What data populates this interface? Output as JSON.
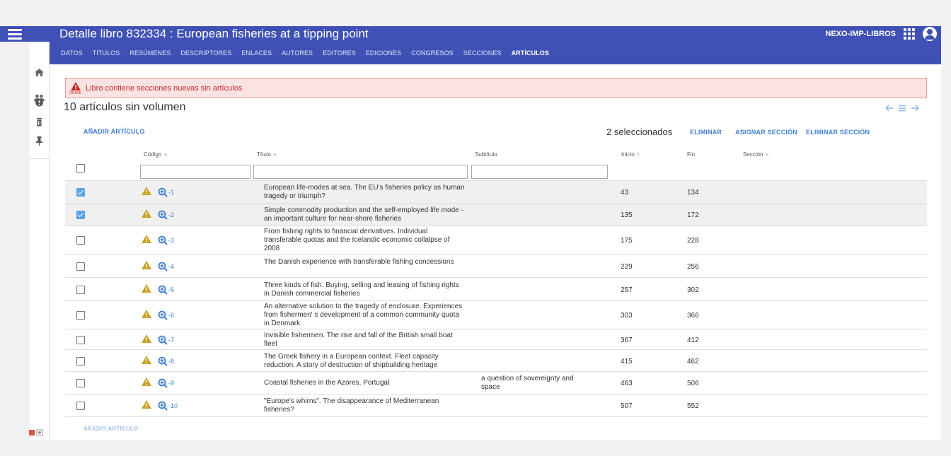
{
  "header": {
    "title": "Detalle libro 832334 : European fisheries at a tipping point",
    "user": "NEXO-IMP-LIBROS",
    "tabs": [
      {
        "label": "DATOS",
        "active": false
      },
      {
        "label": "TÍTULOS",
        "active": false
      },
      {
        "label": "RESÚMENES",
        "active": false
      },
      {
        "label": "DESCRIPTORES",
        "active": false
      },
      {
        "label": "ENLACES",
        "active": false
      },
      {
        "label": "AUTORES",
        "active": false
      },
      {
        "label": "EDITORES",
        "active": false
      },
      {
        "label": "EDICIONES",
        "active": false
      },
      {
        "label": "CONGRESOS",
        "active": false
      },
      {
        "label": "SECCIONES",
        "active": false
      },
      {
        "label": "ARTÍCULOS",
        "active": true
      }
    ]
  },
  "alert": {
    "severity": "GRAVE",
    "message": "Libro contiene secciones nuevas sin artículos"
  },
  "section": {
    "title": "10 artículos sin volumen",
    "add_label": "AÑADIR ARTÍCULO",
    "selected_count": "2 seleccionados",
    "actions": {
      "delete": "ELIMINAR",
      "assign_section": "ASIGNAR SECCIÓN",
      "delete_section": "ELIMINAR SECCIÓN"
    }
  },
  "table": {
    "columns": {
      "code": "Código",
      "title": "Título",
      "subtitle": "Subtítulo",
      "start": "Inicio",
      "end": "Fin",
      "section": "Sección"
    },
    "rows": [
      {
        "checked": true,
        "code": "-1",
        "title": "European life-modes at sea. The EU's fisheries policy as human tragedy or triumph?",
        "subtitle": "",
        "start": "43",
        "end": "134"
      },
      {
        "checked": true,
        "code": "-2",
        "title": "Simple commodity production and the self-employed life mode - an important culture for near-shore fisheries",
        "subtitle": "",
        "start": "135",
        "end": "172"
      },
      {
        "checked": false,
        "code": "-3",
        "title": "From fishing rights to financial derivatives. Individual transferable quotas and the Icelandic economic collalpse of 2008",
        "subtitle": "",
        "start": "175",
        "end": "228"
      },
      {
        "checked": false,
        "code": "-4",
        "title": "The Danish experience with transferable fishing concessions",
        "subtitle": "",
        "start": "229",
        "end": "256"
      },
      {
        "checked": false,
        "code": "-5",
        "title": "Three kinds of fish. Buying, selling and leasing of fishing rights in Danish commercial fisheries",
        "subtitle": "",
        "start": "257",
        "end": "302"
      },
      {
        "checked": false,
        "code": "-6",
        "title": "An alternative solution to the tragedy of enclosure. Experiences from fishermen' s development of a common community quota in Denmark",
        "subtitle": "",
        "start": "303",
        "end": "366"
      },
      {
        "checked": false,
        "code": "-7",
        "title": "Invisible fisherrnen. The rise and fall of the British small boat fleet",
        "subtitle": "",
        "start": "367",
        "end": "412"
      },
      {
        "checked": false,
        "code": "-8",
        "title": "The Greek fishery in a European context. Fleet capacity reduction. A story of destruction of shipbuilding heritage",
        "subtitle": "",
        "start": "415",
        "end": "462"
      },
      {
        "checked": false,
        "code": "-9",
        "title": "Coastal fisheries in the Azores, Portugal",
        "subtitle": "a question of sovereignty and space",
        "start": "463",
        "end": "506"
      },
      {
        "checked": false,
        "code": "-10",
        "title": "\"Europe's whirns\". The disappearance of Mediterranean fisheries?",
        "subtitle": "",
        "start": "507",
        "end": "552"
      }
    ]
  },
  "bottom": {
    "add_label": "AÑADIR ARTÍCULO"
  },
  "icons": {
    "menu": "hamburger-menu-icon",
    "apps": "apps-grid-icon",
    "account": "account-circle-icon",
    "side": [
      "home-icon",
      "people-icon",
      "alert-circle-icon",
      "trash-icon",
      "pin-icon"
    ],
    "warning": "warning-icon",
    "zoom": "zoom-in-icon"
  },
  "colors": {
    "primary": "#3f51b5",
    "link": "#3f7fcf",
    "alert_bg": "#fbe3e4",
    "alert_text": "#c62828",
    "warning": "#c9a227",
    "checkbox_checked": "#5aa3e8"
  }
}
